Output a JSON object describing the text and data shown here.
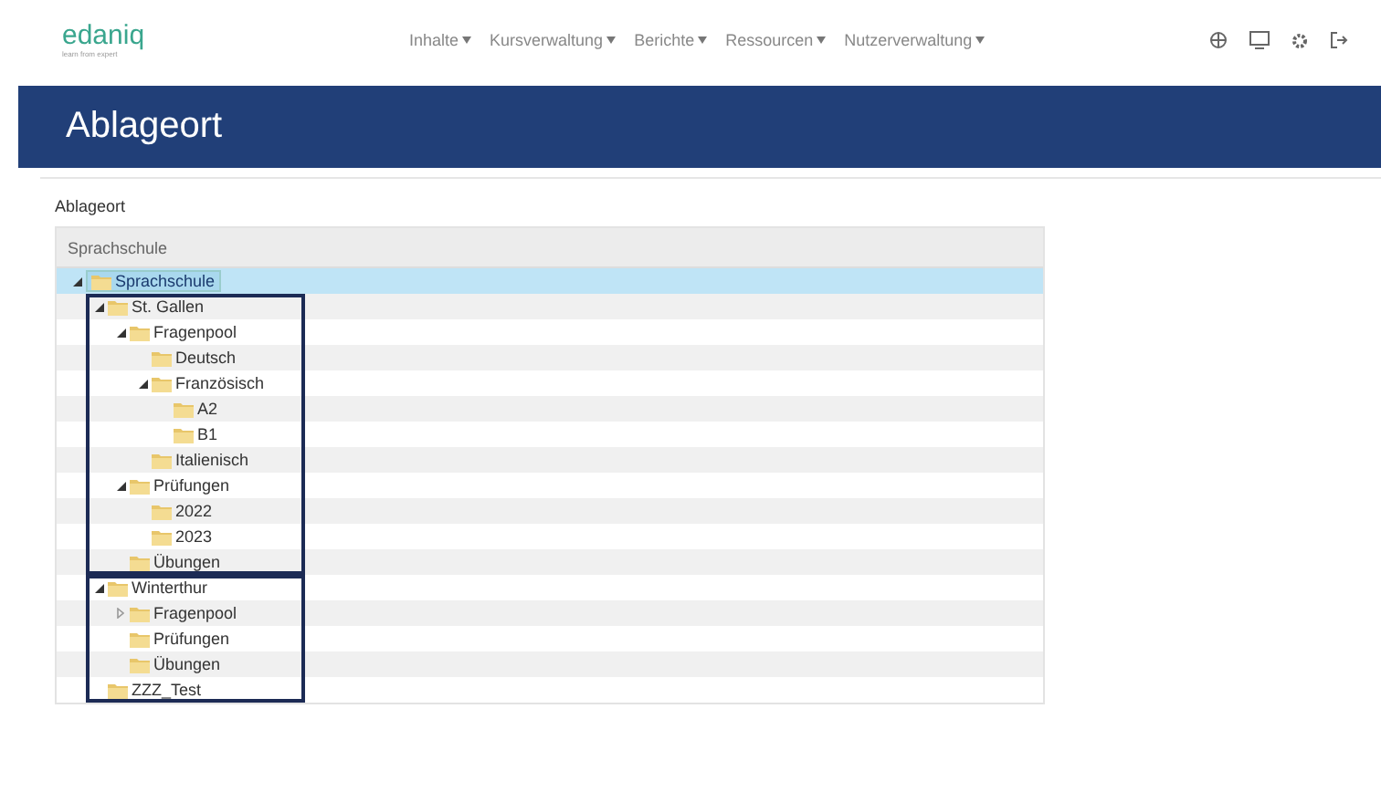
{
  "logo": {
    "text": "edaniq",
    "tagline": "learn from expert"
  },
  "nav": [
    {
      "label": "Inhalte"
    },
    {
      "label": "Kursverwaltung"
    },
    {
      "label": "Berichte"
    },
    {
      "label": "Ressourcen"
    },
    {
      "label": "Nutzerverwaltung"
    }
  ],
  "page_title": "Ablageort",
  "panel": {
    "label": "Ablageort",
    "tree_header": "Sprachschule",
    "root": {
      "label": "Sprachschule",
      "selected": true,
      "expanded": true,
      "child_groups": [
        {
          "outlined": true,
          "children": [
            {
              "label": "St. Gallen",
              "selected": false,
              "expanded": true,
              "children": [
                {
                  "label": "Fragenpool",
                  "selected": false,
                  "expanded": true,
                  "children": [
                    {
                      "label": "Deutsch",
                      "selected": false
                    },
                    {
                      "label": "Französisch",
                      "selected": false,
                      "expanded": true,
                      "children": [
                        {
                          "label": "A2",
                          "selected": false
                        },
                        {
                          "label": "B1",
                          "selected": false
                        }
                      ]
                    },
                    {
                      "label": "Italienisch",
                      "selected": false
                    }
                  ]
                },
                {
                  "label": "Prüfungen",
                  "selected": false,
                  "expanded": true,
                  "children": [
                    {
                      "label": "2022",
                      "selected": false
                    },
                    {
                      "label": "2023",
                      "selected": false
                    }
                  ]
                },
                {
                  "label": "Übungen",
                  "selected": false
                }
              ]
            }
          ]
        },
        {
          "outlined": true,
          "children": [
            {
              "label": "Winterthur",
              "selected": false,
              "expanded": true,
              "children": [
                {
                  "label": "Fragenpool",
                  "selected": false,
                  "expanded": false
                },
                {
                  "label": "Prüfungen",
                  "selected": false
                },
                {
                  "label": "Übungen",
                  "selected": false
                }
              ]
            },
            {
              "label": "ZZZ_Test",
              "selected": false
            }
          ]
        }
      ]
    }
  }
}
